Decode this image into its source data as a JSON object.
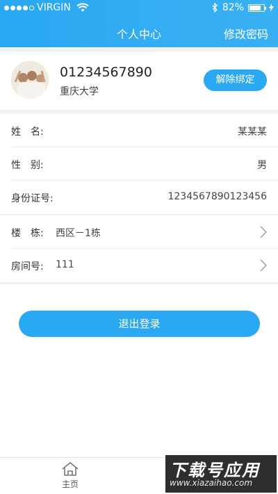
{
  "status_bar": {
    "carrier": "VIRGIN",
    "battery_text": "82%",
    "battery_level": 0.82
  },
  "header": {
    "title": "个人中心",
    "right_action": "修改密码"
  },
  "profile": {
    "phone": "01234567890",
    "school": "重庆大学",
    "unbind_label": "解除绑定"
  },
  "info": {
    "name_label": "姓　名:",
    "name_value": "某某某",
    "gender_label": "性　别:",
    "gender_value": "男",
    "id_label": "身份证号:",
    "id_value": "1234567890123456"
  },
  "dorm": {
    "building_label": "楼　栋:",
    "building_value": "西区－1栋",
    "room_label": "房间号:",
    "room_value": "111"
  },
  "logout_label": "退出登录",
  "tabbar": {
    "home_label": "主页"
  },
  "watermark": {
    "title": "下载号应用",
    "url": "www.xiazaihao.com"
  },
  "colors": {
    "accent": "#2aa8f2",
    "background": "#f2f2f2"
  }
}
